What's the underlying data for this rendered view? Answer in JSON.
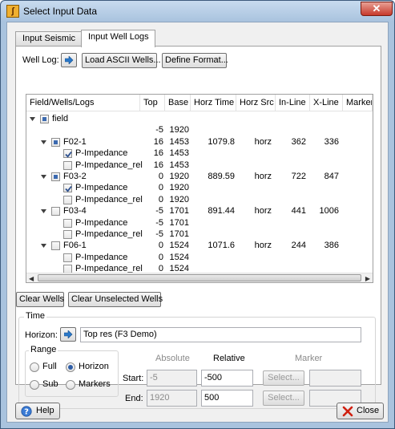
{
  "window": {
    "title": "Select Input Data"
  },
  "tabs": [
    {
      "label": "Input Seismic"
    },
    {
      "label": "Input Well Logs"
    }
  ],
  "well_log": {
    "label": "Well Log:",
    "load_ascii_label": "Load ASCII Wells...",
    "define_format_label": "Define Format..."
  },
  "tree": {
    "columns": [
      "Field/Wells/Logs",
      "Top",
      "Base",
      "Horz Time",
      "Horz Src",
      "In-Line",
      "X-Line",
      "Marker-T"
    ],
    "rows": [
      {
        "name": "field",
        "top": "",
        "base": "",
        "horz_time": "",
        "horz_src": "",
        "inline": "",
        "xline": ""
      },
      {
        "name": "",
        "top": "-5",
        "base": "1920",
        "horz_time": "",
        "horz_src": "",
        "inline": "",
        "xline": ""
      },
      {
        "name": "F02-1",
        "top": "16",
        "base": "1453",
        "horz_time": "1079.8",
        "horz_src": "horz",
        "inline": "362",
        "xline": "336"
      },
      {
        "name": "P-Impedance",
        "top": "16",
        "base": "1453",
        "horz_time": "",
        "horz_src": "",
        "inline": "",
        "xline": ""
      },
      {
        "name": "P-Impedance_rel",
        "top": "16",
        "base": "1453",
        "horz_time": "",
        "horz_src": "",
        "inline": "",
        "xline": ""
      },
      {
        "name": "F03-2",
        "top": "0",
        "base": "1920",
        "horz_time": "889.59",
        "horz_src": "horz",
        "inline": "722",
        "xline": "847"
      },
      {
        "name": "P-Impedance",
        "top": "0",
        "base": "1920",
        "horz_time": "",
        "horz_src": "",
        "inline": "",
        "xline": ""
      },
      {
        "name": "P-Impedance_rel",
        "top": "0",
        "base": "1920",
        "horz_time": "",
        "horz_src": "",
        "inline": "",
        "xline": ""
      },
      {
        "name": "F03-4",
        "top": "-5",
        "base": "1701",
        "horz_time": "891.44",
        "horz_src": "horz",
        "inline": "441",
        "xline": "1006"
      },
      {
        "name": "P-Impedance",
        "top": "-5",
        "base": "1701",
        "horz_time": "",
        "horz_src": "",
        "inline": "",
        "xline": ""
      },
      {
        "name": "P-Impedance_rel",
        "top": "-5",
        "base": "1701",
        "horz_time": "",
        "horz_src": "",
        "inline": "",
        "xline": ""
      },
      {
        "name": "F06-1",
        "top": "0",
        "base": "1524",
        "horz_time": "1071.6",
        "horz_src": "horz",
        "inline": "244",
        "xline": "386"
      },
      {
        "name": "P-Impedance",
        "top": "0",
        "base": "1524",
        "horz_time": "",
        "horz_src": "",
        "inline": "",
        "xline": ""
      },
      {
        "name": "P-Impedance_rel",
        "top": "0",
        "base": "1524",
        "horz_time": "",
        "horz_src": "",
        "inline": "",
        "xline": ""
      }
    ]
  },
  "actions": {
    "clear_wells_label": "Clear Wells",
    "clear_unselected_label": "Clear Unselected Wells"
  },
  "time": {
    "label": "Time",
    "horizon_label": "Horizon:",
    "horizon_value": "Top res (F3 Demo)"
  },
  "range": {
    "label": "Range",
    "options": [
      "Full",
      "Horizon",
      "Sub",
      "Markers"
    ],
    "selected": "Horizon"
  },
  "limits": {
    "absolute_label": "Absolute",
    "relative_label": "Relative",
    "marker_label": "Marker",
    "start_label": "Start:",
    "end_label": "End:",
    "start_absolute": "-5",
    "start_relative": "-500",
    "end_absolute": "1920",
    "end_relative": "500",
    "select_label": "Select..."
  },
  "footer": {
    "help_label": "Help",
    "close_label": "Close"
  },
  "colors": {
    "frame": "#a9c3de",
    "close_button": "#c7392b",
    "partial_check": "#3c6ab0"
  }
}
